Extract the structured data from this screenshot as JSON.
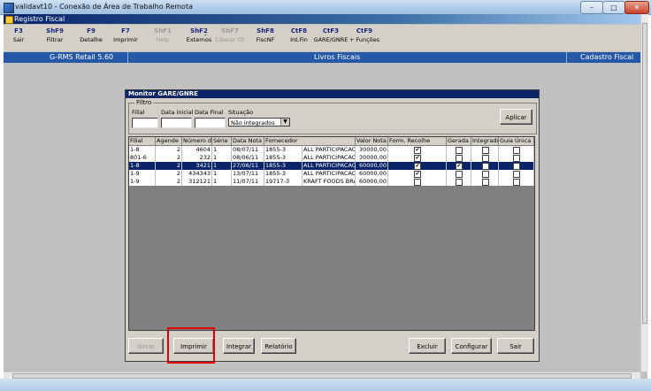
{
  "window": {
    "title": "validavt10 - Conexão de Área de Trabalho Remota",
    "min": "–",
    "max": "□",
    "close": "✕"
  },
  "app": {
    "title": "Registro Fiscal",
    "toolbar": [
      {
        "key": "F3",
        "label": "Sair",
        "enabled": true
      },
      {
        "key": "ShF9",
        "label": "Filtrar",
        "enabled": true
      },
      {
        "key": "F9",
        "label": "Detalhe",
        "enabled": true
      },
      {
        "key": "F7",
        "label": "Imprimir",
        "enabled": true
      },
      {
        "key": "ShF1",
        "label": "Help",
        "enabled": false
      },
      {
        "key": "ShF2",
        "label": "Externos",
        "enabled": true
      },
      {
        "key": "ShF7",
        "label": "Liberar Ot",
        "enabled": false
      },
      {
        "key": "ShF8",
        "label": "FiscNF",
        "enabled": true
      },
      {
        "key": "CtF8",
        "label": "Int.Fin",
        "enabled": true
      },
      {
        "key": "CtF3",
        "label": "GARE/GNRE",
        "enabled": true
      },
      {
        "key": "CtF9",
        "label": "+ Funções",
        "enabled": true
      }
    ],
    "toolbar_dash": "-",
    "bluebar": {
      "left": "G-RMS Retail 5.60",
      "center": "Livros Fiscais",
      "right": "Cadastro Fiscal"
    }
  },
  "dialog": {
    "title": "Monitor GARE/GNRE",
    "filter": {
      "legend": "Filtro",
      "filial_label": "Filial",
      "data_inicial_label": "Data Inicial",
      "data_final_label": "Data Final",
      "situacao_label": "Situação",
      "situacao_value": "Não integrados",
      "apply_button": "Aplicar"
    },
    "columns": [
      "Filial",
      "Agende",
      "Número di",
      "Série",
      "Data Nota",
      "Fornecedor",
      "",
      "Valor Nota",
      "Form. Recolhe",
      "Gerada",
      "Integrado",
      "Guia Única"
    ],
    "rows": [
      {
        "filial": "1-8",
        "agende": "2",
        "numero": "4604",
        "serie": "1",
        "data": "08/07/11",
        "forn_cod": "1855-3",
        "forn_nome": "ALL PARTICIPACAO ADM",
        "valor": "30000,00",
        "form": true,
        "gerada": false,
        "integrado": false,
        "guia": false,
        "selected": false
      },
      {
        "filial": "801-6",
        "agende": "2",
        "numero": "232",
        "serie": "1",
        "data": "08/06/11",
        "forn_cod": "1855-3",
        "forn_nome": "ALL PARTICIPACAO ADM",
        "valor": "30000,00",
        "form": true,
        "gerada": false,
        "integrado": false,
        "guia": false,
        "selected": false
      },
      {
        "filial": "1-8",
        "agende": "2",
        "numero": "3421",
        "serie": "1",
        "data": "27/06/11",
        "forn_cod": "1855-3",
        "forn_nome": "ALL PARTICIPACAO ADM",
        "valor": "60000,00",
        "form": true,
        "gerada": true,
        "integrado": false,
        "guia": false,
        "selected": true
      },
      {
        "filial": "1-9",
        "agende": "2",
        "numero": "434343",
        "serie": "1",
        "data": "13/07/11",
        "forn_cod": "1855-3",
        "forn_nome": "ALL PARTICIPACAO ADM",
        "valor": "60000,00",
        "form": true,
        "gerada": false,
        "integrado": false,
        "guia": false,
        "selected": false
      },
      {
        "filial": "1-9",
        "agende": "2",
        "numero": "312121",
        "serie": "1",
        "data": "11/07/11",
        "forn_cod": "19717-3",
        "forn_nome": "KRAFT FOODS BRASIL S",
        "valor": "60000,00",
        "form": false,
        "gerada": false,
        "integrado": false,
        "guia": false,
        "selected": false
      }
    ],
    "buttons": {
      "gerar": "Gerar",
      "imprimir": "Imprimir",
      "integrar": "Integrar",
      "relatorio": "Relatório",
      "excluir": "Excluir",
      "configurar": "Configurar",
      "sair": "Sair"
    },
    "check_mark": "✔"
  }
}
